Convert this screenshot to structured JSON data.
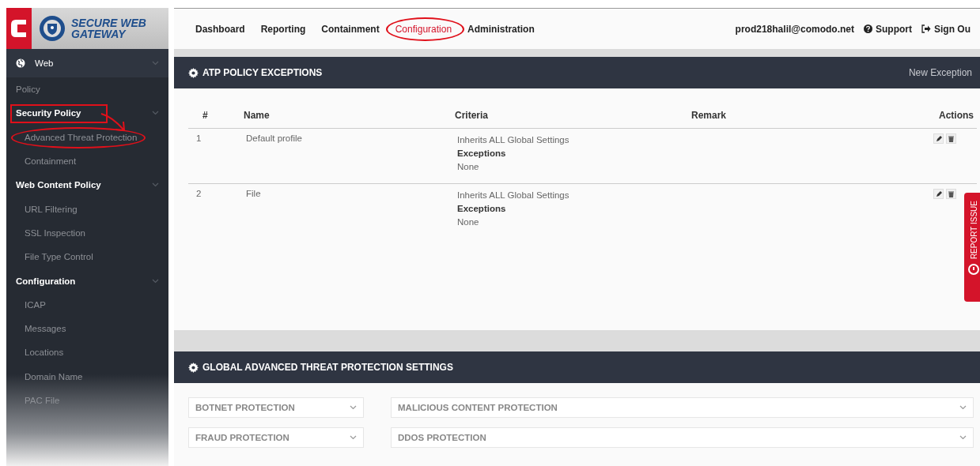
{
  "logo": {
    "title": "SECURE WEB",
    "subtitle": "GATEWAY"
  },
  "nav": [
    {
      "label": "Dashboard",
      "selected": false
    },
    {
      "label": "Reporting",
      "selected": false
    },
    {
      "label": "Containment",
      "selected": false
    },
    {
      "label": "Configuration",
      "selected": true,
      "circled": true
    },
    {
      "label": "Administration",
      "selected": false
    }
  ],
  "user": "prod218halil@comodo.net",
  "links": [
    {
      "kind": "support",
      "label": "Support"
    },
    {
      "kind": "signout",
      "label": "Sign Ou"
    }
  ],
  "sidebar": {
    "items": [
      {
        "kind": "section",
        "label": "Web"
      },
      {
        "kind": "link",
        "label": "Policy"
      },
      {
        "kind": "group",
        "label": "Security Policy",
        "boxed": true
      },
      {
        "kind": "sub",
        "label": "Advanced Threat Protection",
        "circled": true
      },
      {
        "kind": "sub",
        "label": "Containment"
      },
      {
        "kind": "group",
        "label": "Web Content Policy"
      },
      {
        "kind": "sub",
        "label": "URL Filtering"
      },
      {
        "kind": "sub",
        "label": "SSL Inspection"
      },
      {
        "kind": "sub",
        "label": "File Type Control"
      },
      {
        "kind": "group",
        "label": "Configuration"
      },
      {
        "kind": "sub",
        "label": "ICAP"
      },
      {
        "kind": "sub",
        "label": "Messages"
      },
      {
        "kind": "sub",
        "label": "Locations"
      },
      {
        "kind": "sub",
        "label": "Domain Name"
      },
      {
        "kind": "sub",
        "label": "PAC File"
      }
    ]
  },
  "exceptions_panel": {
    "title": "ATP POLICY EXCEPTIONS",
    "action": "New Exception",
    "columns": [
      "#",
      "Name",
      "Criteria",
      "Remark",
      "Actions"
    ],
    "rows": [
      {
        "number": "1",
        "name": "Default profile",
        "criteria": "Inherits ALL Global Settings",
        "exceptions_label": "Exceptions",
        "exceptions": "None"
      },
      {
        "number": "2",
        "name": "File",
        "criteria": "Inherits ALL Global Settings",
        "exceptions_label": "Exceptions",
        "exceptions": "None"
      }
    ]
  },
  "settings_panel": {
    "title": "GLOBAL ADVANCED THREAT PROTECTION SETTINGS",
    "sections": [
      "BOTNET PROTECTION",
      "MALICIOUS CONTENT PROTECTION",
      "FRAUD PROTECTION",
      "DDOS PROTECTION"
    ]
  },
  "report_tab": {
    "label": "REPORT ISSUE"
  }
}
